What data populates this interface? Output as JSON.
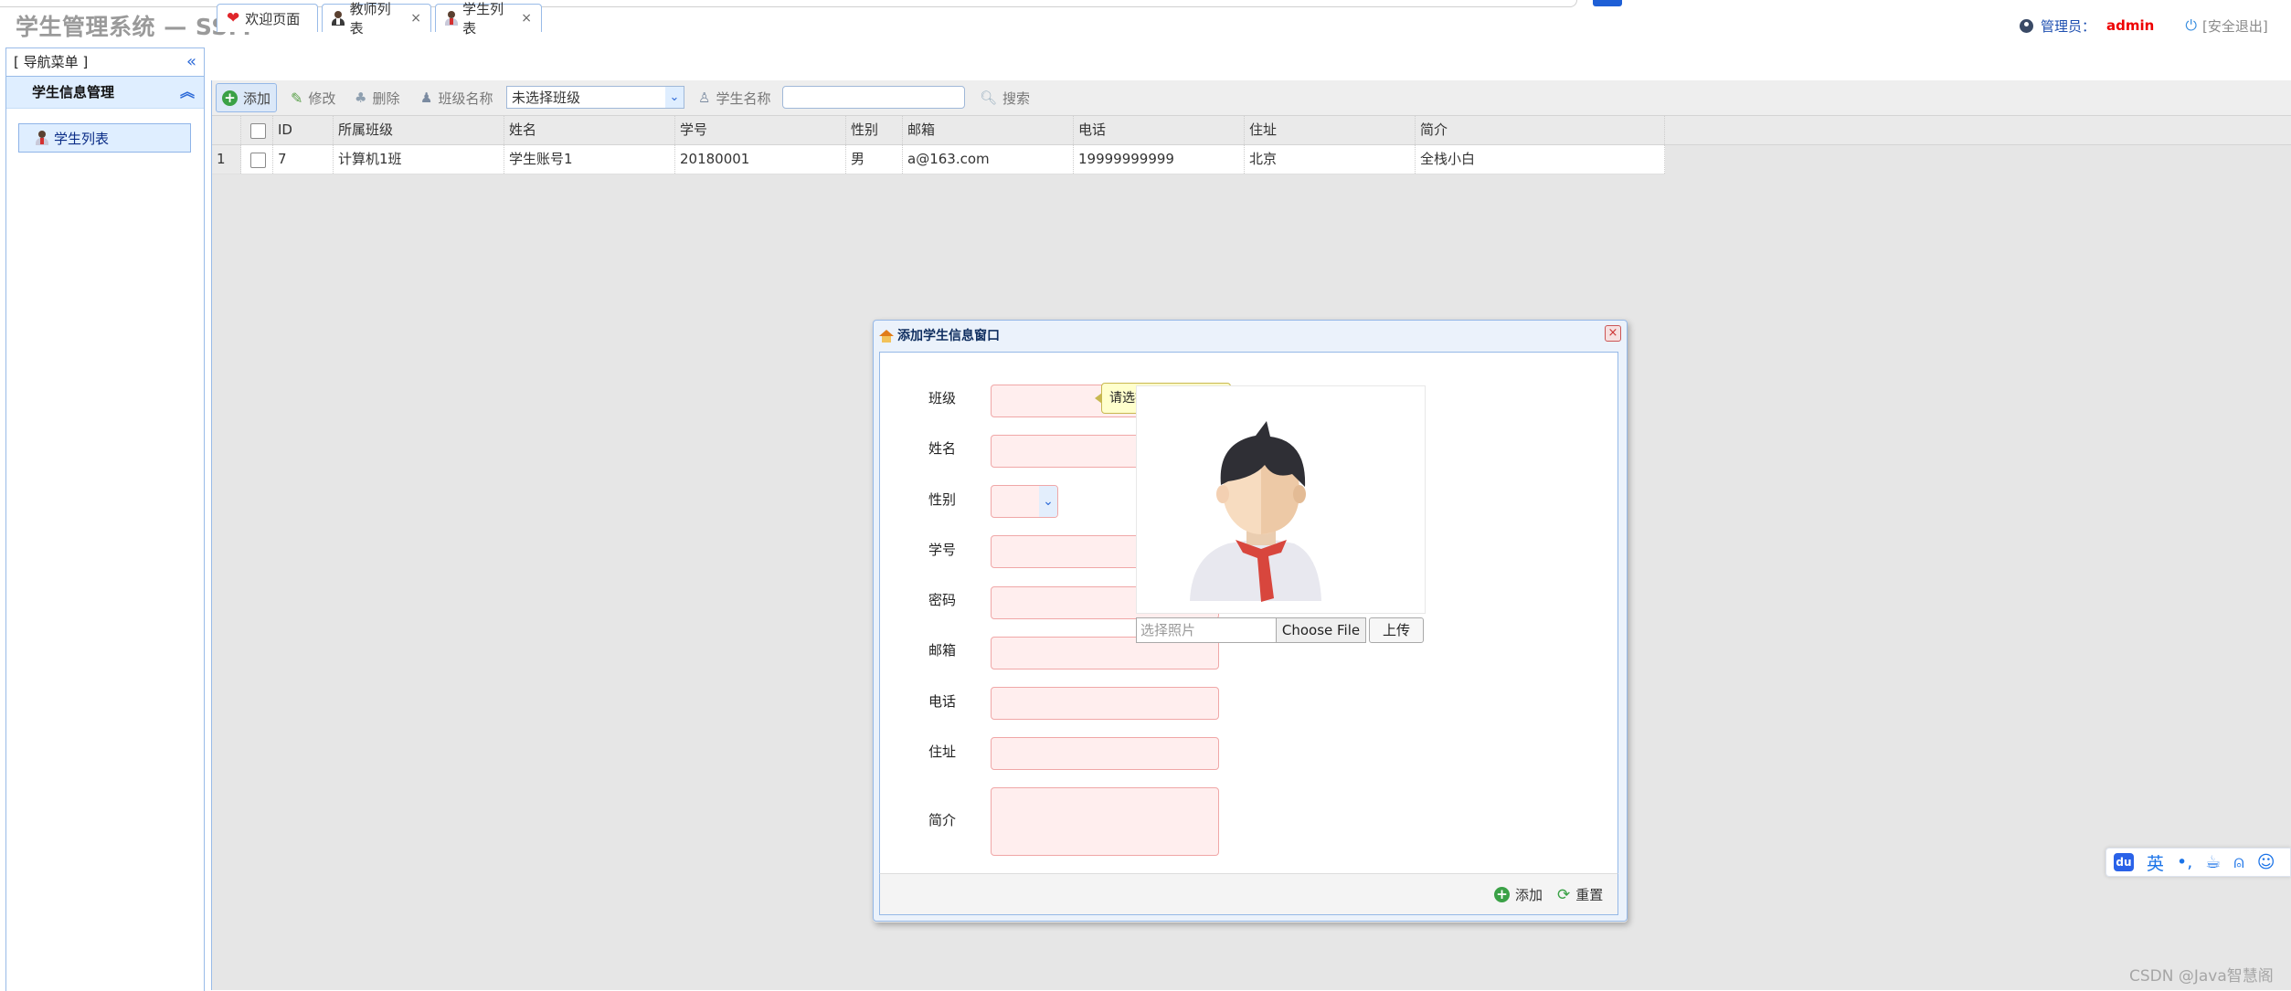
{
  "app": {
    "title": "学生管理系统 — SSM"
  },
  "header": {
    "role_label": "管理员：",
    "username": "admin",
    "logout": "[安全退出]"
  },
  "sidebar": {
    "title": "[ 导航菜单 ]",
    "group": "学生信息管理",
    "items": [
      {
        "label": "学生列表"
      }
    ]
  },
  "tabs": [
    {
      "label": "欢迎页面"
    },
    {
      "label": "教师列表"
    },
    {
      "label": "学生列表"
    }
  ],
  "toolbar": {
    "add": "添加",
    "edit": "修改",
    "delete": "删除",
    "class_label": "班级名称",
    "class_select": "未选择班级",
    "student_name_label": "学生名称",
    "search": "搜索"
  },
  "table": {
    "columns": [
      "ID",
      "所属班级",
      "姓名",
      "学号",
      "性别",
      "邮箱",
      "电话",
      "住址",
      "简介"
    ],
    "rows": [
      {
        "rownum": "1",
        "cells": [
          "7",
          "计算机1班",
          "学生账号1",
          "20180001",
          "男",
          "a@163.com",
          "19999999999",
          "北京",
          "全栈小白"
        ]
      }
    ]
  },
  "dialog": {
    "title": "添加学生信息窗口",
    "labels": {
      "class": "班级",
      "name": "姓名",
      "gender": "性别",
      "student_no": "学号",
      "password": "密码",
      "email": "邮箱",
      "phone": "电话",
      "address": "住址",
      "intro": "简介"
    },
    "tooltip": "请选择所属班级哟~",
    "photo_placeholder": "选择照片",
    "choose_file": "Choose File",
    "upload": "上传",
    "submit": "添加",
    "reset": "重置"
  },
  "ime": {
    "lang": "英"
  },
  "watermark": "CSDN @Java智慧阁",
  "colors": {
    "accent_blue": "#95b8e7",
    "invalid_field_bg": "#ffeeee",
    "invalid_field_border": "#f0a7a7",
    "admin_name": "#ee0000"
  }
}
